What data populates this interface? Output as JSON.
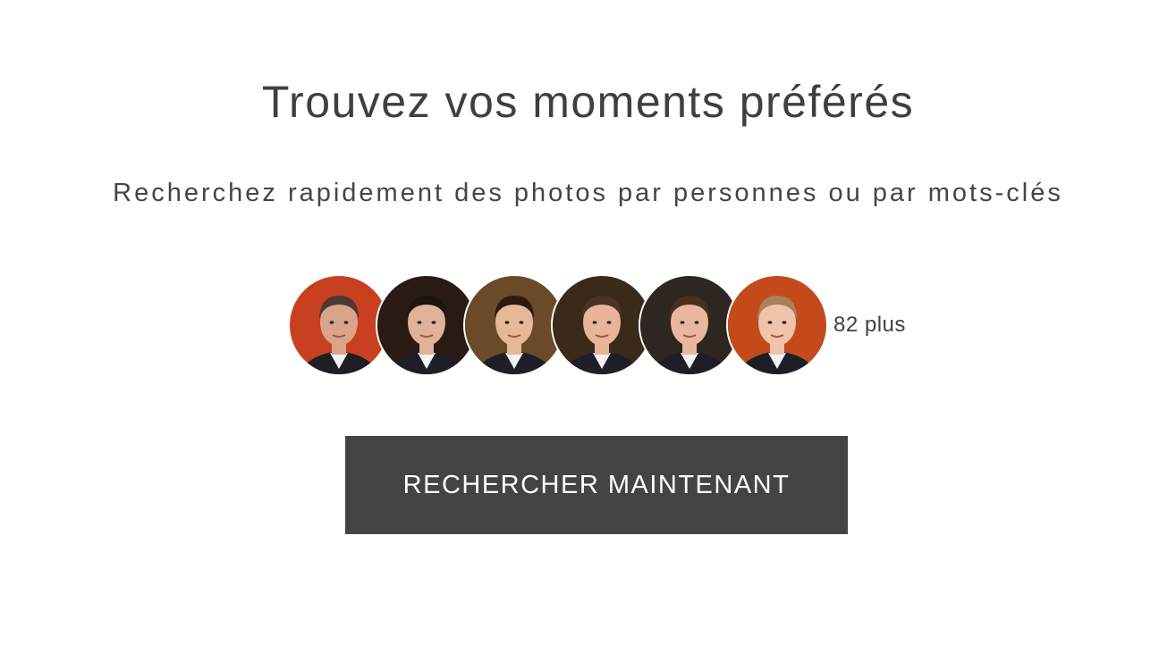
{
  "heading": "Trouvez vos moments préférés",
  "subheading": "Recherchez rapidement des photos par personnes ou par mots-clés",
  "people": {
    "avatars": [
      {
        "name": "person-avatar-1",
        "bg": "#c8401f",
        "skin": "#d9a48a",
        "hair": "#4a3a32"
      },
      {
        "name": "person-avatar-2",
        "bg": "#2a1a14",
        "skin": "#e0b29a",
        "hair": "#1c1510"
      },
      {
        "name": "person-avatar-3",
        "bg": "#6b4a2a",
        "skin": "#e6b898",
        "hair": "#2b1a12"
      },
      {
        "name": "person-avatar-4",
        "bg": "#3a2a1a",
        "skin": "#e8b49a",
        "hair": "#4a3322"
      },
      {
        "name": "person-avatar-5",
        "bg": "#2e2620",
        "skin": "#e9b7a0",
        "hair": "#4a2e1e"
      },
      {
        "name": "person-avatar-6",
        "bg": "#c44a1c",
        "skin": "#efc4aa",
        "hair": "#a8805a"
      }
    ],
    "more_label": "82 plus"
  },
  "cta_label": "RECHERCHER MAINTENANT"
}
